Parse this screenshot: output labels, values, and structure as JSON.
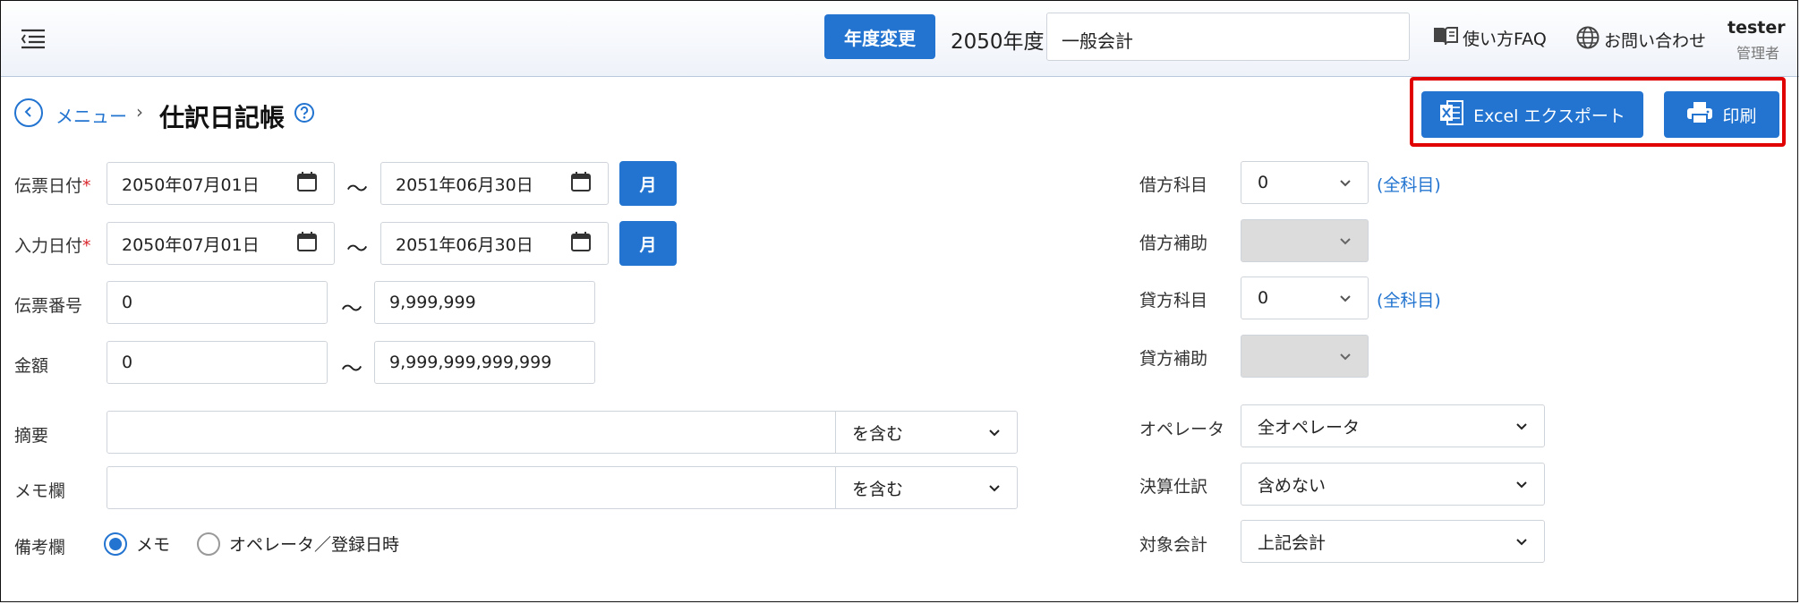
{
  "header": {
    "year_button": "年度変更",
    "year_text": "2050年度",
    "accounting_value": "一般会計",
    "faq_label": "使い方FAQ",
    "contact_label": "お問い合わせ",
    "user_name": "tester",
    "user_role": "管理者"
  },
  "breadcrumb": {
    "menu": "メニュー",
    "separator": "›",
    "title": "仕訳日記帳"
  },
  "actions": {
    "excel_label": "Excel エクスポート",
    "print_label": "印刷"
  },
  "form_left": {
    "slip_date": {
      "label": "伝票日付",
      "required": "*",
      "from": "2050年07月01日",
      "to": "2051年06月30日",
      "month_button": "月"
    },
    "input_date": {
      "label": "入力日付",
      "required": "*",
      "from": "2050年07月01日",
      "to": "2051年06月30日",
      "month_button": "月"
    },
    "slip_number": {
      "label": "伝票番号",
      "from": "0",
      "to": "9,999,999"
    },
    "amount": {
      "label": "金額",
      "from": "0",
      "to": "9,999,999,999,999"
    },
    "summary": {
      "label": "摘要",
      "value": "",
      "match": "を含む"
    },
    "memo": {
      "label": "メモ欄",
      "value": "",
      "match": "を含む"
    },
    "remarks": {
      "label": "備考欄",
      "options": [
        "メモ",
        "オペレータ／登録日時"
      ],
      "selected": "メモ"
    },
    "tilde": "～"
  },
  "form_right": {
    "debit_account": {
      "label": "借方科目",
      "value": "0",
      "link": "(全科目)"
    },
    "debit_sub": {
      "label": "借方補助",
      "value": ""
    },
    "credit_account": {
      "label": "貸方科目",
      "value": "0",
      "link": "(全科目)"
    },
    "credit_sub": {
      "label": "貸方補助",
      "value": ""
    },
    "operator": {
      "label": "オペレータ",
      "value": "全オペレータ"
    },
    "settlement": {
      "label": "決算仕訳",
      "value": "含めない"
    },
    "target": {
      "label": "対象会計",
      "value": "上記会計"
    }
  },
  "colors": {
    "primary": "#2274d0",
    "highlight": "#e00000"
  }
}
